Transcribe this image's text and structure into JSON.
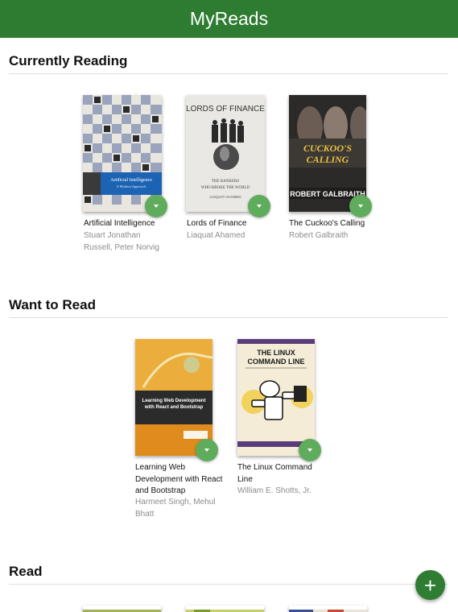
{
  "header": {
    "title": "MyReads"
  },
  "shelves": [
    {
      "title": "Currently Reading",
      "books": [
        {
          "title": "Artificial Intelligence",
          "authors": "Stuart Jonathan Russell, Peter Norvig",
          "cover_text": "Artificial Intelligence\nA Modern Approach"
        },
        {
          "title": "Lords of Finance",
          "authors": "Liaquat Ahamed",
          "cover_text": "LORDS OF FINANCE\nTHE BANKERS WHO BROKE THE WORLD\nLIAQUAT AHAMED"
        },
        {
          "title": "The Cuckoo's Calling",
          "authors": "Robert Galbraith",
          "cover_text": "THE CUCKOO'S CALLING\nROBERT GALBRAITH"
        }
      ]
    },
    {
      "title": "Want to Read",
      "books": [
        {
          "title": "Learning Web Development with React and Bootstrap",
          "authors": "Harmeet Singh, Mehul Bhatt",
          "cover_text": "Learning Web Development with React and Bootstrap"
        },
        {
          "title": "The Linux Command Line",
          "authors": "William E. Shotts, Jr.",
          "cover_text": "THE LINUX COMMAND LINE"
        }
      ]
    },
    {
      "title": "Read",
      "books": []
    }
  ],
  "colors": {
    "header": "#2e7c31",
    "changer": "#60ac5d",
    "add_button": "#2e7d32"
  },
  "icons": {
    "shelf_changer": "triangle-down-icon",
    "add": "plus-icon"
  },
  "add_button_label": "+"
}
